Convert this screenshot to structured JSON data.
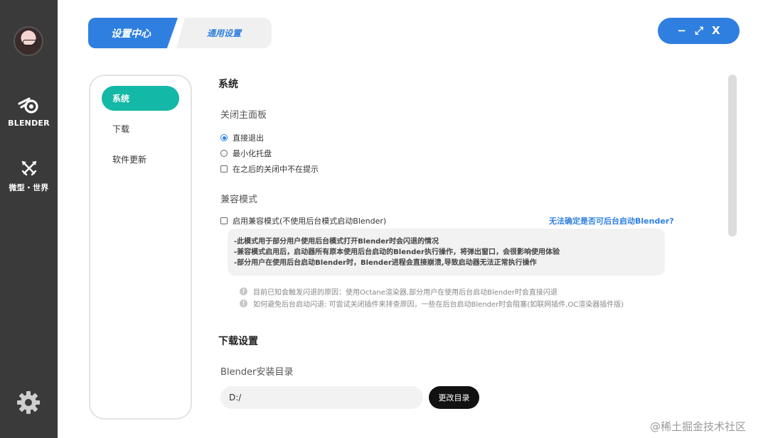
{
  "rail": {
    "apps": [
      {
        "label": "BLENDER",
        "icon": "blender-icon"
      },
      {
        "label": "微型・世界",
        "icon": "crossed-swords-icon"
      }
    ],
    "settings_icon": "gear-icon"
  },
  "tabs": [
    {
      "label": "设置中心",
      "active": true
    },
    {
      "label": "通用设置",
      "active": false
    }
  ],
  "window_controls": {
    "minimize": "−",
    "maximize": "⤢",
    "close": "X"
  },
  "nav": {
    "items": [
      {
        "label": "系统",
        "active": true
      },
      {
        "label": "下载",
        "active": false
      },
      {
        "label": "软件更新",
        "active": false
      }
    ]
  },
  "system": {
    "title": "系统",
    "close_panel": {
      "title": "关闭主面板",
      "options": [
        {
          "label": "直接退出",
          "type": "radio",
          "checked": true
        },
        {
          "label": "最小化托盘",
          "type": "radio",
          "checked": false
        },
        {
          "label": "在之后的关闭中不在提示",
          "type": "checkbox",
          "checked": false
        }
      ]
    },
    "compat": {
      "title": "兼容模式",
      "checkbox_label": "启用兼容模式(不使用后台模式启动Blender)",
      "help_link": "无法确定是否可后台启动Blender?",
      "notes": [
        "-此模式用于部分用户使用后台模式打开Blender时会闪退的情况",
        "-兼容模式启用后，启动器所有原本使用后台启动的Blender执行操作，将弹出窗口，会很影响使用体验",
        "-部分用户在使用后台启动Blender时，Blender进程会直接崩溃,导致启动器无法正常执行操作"
      ],
      "tips": [
        "目前已知会触发闪退的原因：使用Octane渲染器,部分用户在使用后台启动Blender时会直接闪退",
        "如何避免后台启动闪退: 可尝试关闭插件来排查原因，一些在后台启动Blender时会阻塞(如联网插件,OC渲染器插件版)"
      ]
    }
  },
  "download": {
    "title": "下载设置",
    "install_dir_label": "Blender安装目录",
    "install_dir_value": "D:/",
    "change_button": "更改目录"
  },
  "watermark": "@稀土掘金技术社区"
}
